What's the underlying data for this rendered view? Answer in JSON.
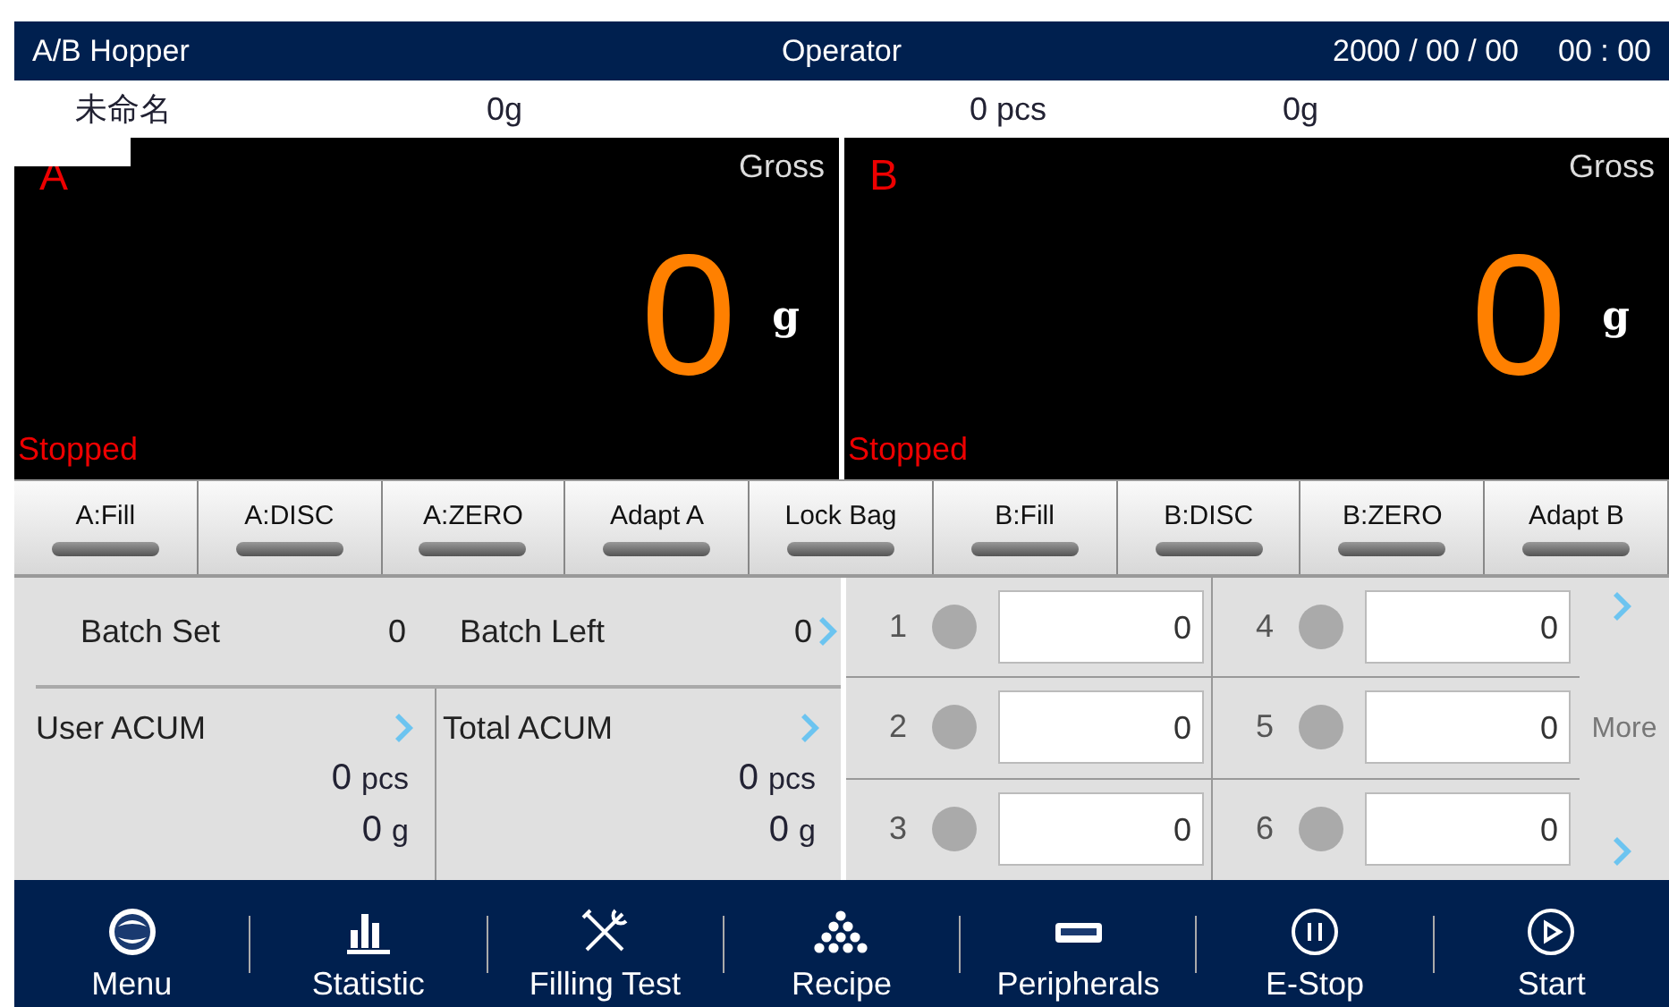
{
  "header": {
    "title": "A/B Hopper",
    "role": "Operator",
    "date": "2000 / 00 / 00",
    "time": "00 : 00"
  },
  "info": {
    "name": "未命名",
    "weight_a": "0g",
    "count": "0 pcs",
    "weight_b": "0g"
  },
  "scales": [
    {
      "label": "A",
      "mode": "Gross",
      "value": "0",
      "unit": "g",
      "status": "Stopped"
    },
    {
      "label": "B",
      "mode": "Gross",
      "value": "0",
      "unit": "g",
      "status": "Stopped"
    }
  ],
  "function_buttons": [
    "A:Fill",
    "A:DISC",
    "A:ZERO",
    "Adapt A",
    "Lock Bag",
    "B:Fill",
    "B:DISC",
    "B:ZERO",
    "Adapt B"
  ],
  "batch": {
    "set_label": "Batch Set",
    "set_value": "0",
    "left_label": "Batch Left",
    "left_value": "0"
  },
  "accums": [
    {
      "label": "User ACUM",
      "pcs": "0",
      "pcs_unit": "pcs",
      "grams": "0",
      "grams_unit": "g"
    },
    {
      "label": "Total ACUM",
      "pcs": "0",
      "pcs_unit": "pcs",
      "grams": "0",
      "grams_unit": "g"
    }
  ],
  "hoppers": [
    {
      "number": "1",
      "value": "0"
    },
    {
      "number": "4",
      "value": "0"
    },
    {
      "number": "2",
      "value": "0"
    },
    {
      "number": "5",
      "value": "0"
    },
    {
      "number": "3",
      "value": "0"
    },
    {
      "number": "6",
      "value": "0"
    }
  ],
  "more_label": "More",
  "nav": [
    {
      "kind": "menu",
      "label": "Menu"
    },
    {
      "kind": "statistic",
      "label": "Statistic"
    },
    {
      "kind": "tools",
      "label": "Filling Test"
    },
    {
      "kind": "recipe",
      "label": "Recipe"
    },
    {
      "kind": "peripherals",
      "label": "Peripherals"
    },
    {
      "kind": "pause",
      "label": "E-Stop"
    },
    {
      "kind": "play",
      "label": "Start"
    }
  ]
}
